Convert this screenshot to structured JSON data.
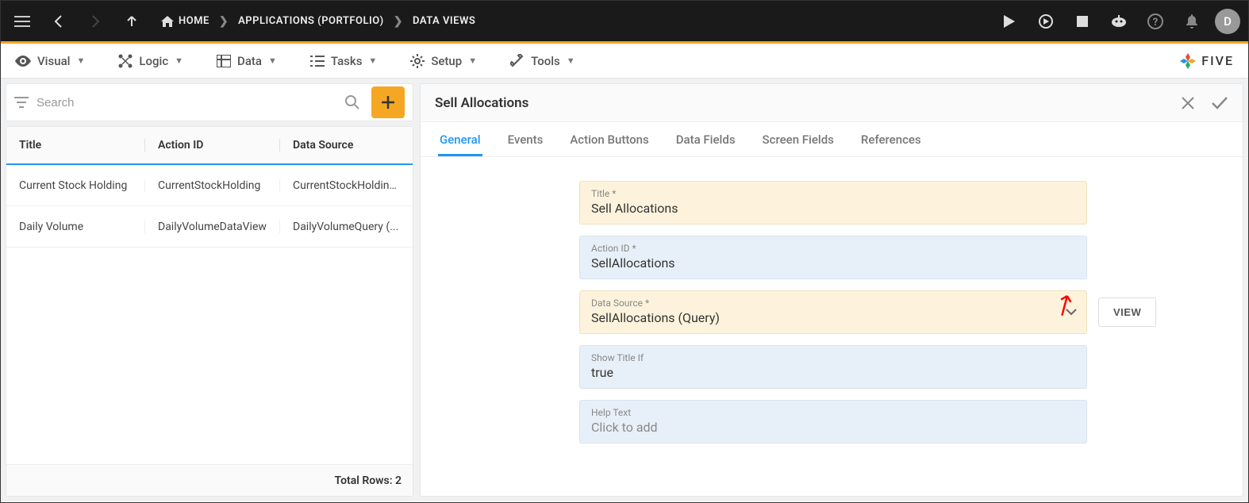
{
  "topbar": {
    "breadcrumbs": [
      "HOME",
      "APPLICATIONS (PORTFOLIO)",
      "DATA VIEWS"
    ],
    "avatar_initial": "D"
  },
  "menubar": {
    "items": [
      "Visual",
      "Logic",
      "Data",
      "Tasks",
      "Setup",
      "Tools"
    ],
    "brand": "FIVE"
  },
  "left": {
    "search_placeholder": "Search",
    "columns": [
      "Title",
      "Action ID",
      "Data Source"
    ],
    "rows": [
      {
        "title": "Current Stock Holding",
        "action_id": "CurrentStockHolding",
        "data_source": "CurrentStockHolding..."
      },
      {
        "title": "Daily Volume",
        "action_id": "DailyVolumeDataView",
        "data_source": "DailyVolumeQuery (..."
      }
    ],
    "footer_label": "Total Rows:",
    "footer_count": "2"
  },
  "detail": {
    "title": "Sell Allocations",
    "tabs": [
      "General",
      "Events",
      "Action Buttons",
      "Data Fields",
      "Screen Fields",
      "References"
    ],
    "active_tab": 0,
    "fields": {
      "title": {
        "label": "Title *",
        "value": "Sell Allocations"
      },
      "action_id": {
        "label": "Action ID *",
        "value": "SellAllocations"
      },
      "data_source": {
        "label": "Data Source *",
        "value": "SellAllocations (Query)"
      },
      "show_title_if": {
        "label": "Show Title If",
        "value": "true"
      },
      "help_text": {
        "label": "Help Text",
        "value": "Click to add"
      }
    },
    "view_button": "VIEW"
  }
}
